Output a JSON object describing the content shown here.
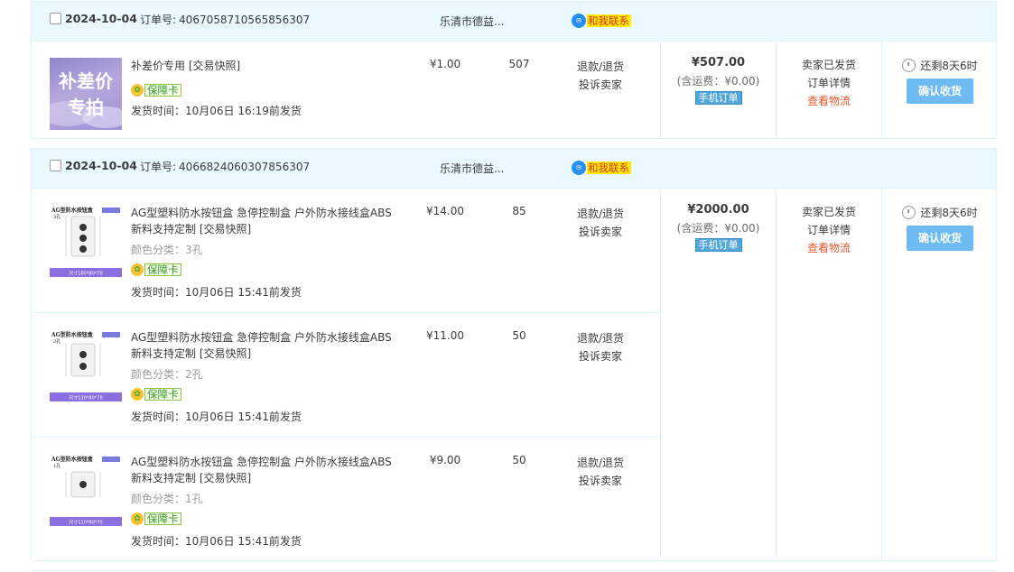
{
  "orders": [
    {
      "date": "2024-10-04",
      "order_label": "订单号:",
      "order_no": "4067058710565856307",
      "shop": "乐清市德益...",
      "contact": "和我联系",
      "items": [
        {
          "thumb_text": [
            "补差价",
            "专拍"
          ],
          "title": "补差价专用 [交易快照]",
          "sku": "",
          "guarantee": "保障卡",
          "ship": "发货时间：10月06日 16:19前发货",
          "price": "¥1.00",
          "qty": "507",
          "refund": "退款/退货",
          "complain": "投诉卖家"
        }
      ],
      "total": "¥507.00",
      "freight": "(含运费：¥0.00)",
      "mobile": "手机订单",
      "status": "卖家已发货",
      "detail": "订单详情",
      "logistics": "查看物流",
      "remain": "还剩8天6时",
      "confirm": "确认收货"
    },
    {
      "date": "2024-10-04",
      "order_label": "订单号:",
      "order_no": "4066824060307856307",
      "shop": "乐清市德益...",
      "contact": "和我联系",
      "items": [
        {
          "thumb_title": "AG型防水按钮盒",
          "thumb_sub": "3孔",
          "thumb_foot": "尺寸180*80*70",
          "title": "AG型塑料防水按钮盒 急停控制盒 户外防水接线盒ABS新料支持定制 [交易快照]",
          "sku": "颜色分类：3孔",
          "guarantee": "保障卡",
          "ship": "发货时间：10月06日 15:41前发货",
          "price": "¥14.00",
          "qty": "85",
          "refund": "退款/退货",
          "complain": "投诉卖家"
        },
        {
          "thumb_title": "AG型防水按钮盒",
          "thumb_sub": "2孔",
          "thumb_foot": "尺寸130*80*70",
          "title": "AG型塑料防水按钮盒 急停控制盒 户外防水接线盒ABS新料支持定制 [交易快照]",
          "sku": "颜色分类：2孔",
          "guarantee": "保障卡",
          "ship": "发货时间：10月06日 15:41前发货",
          "price": "¥11.00",
          "qty": "50",
          "refund": "退款/退货",
          "complain": "投诉卖家"
        },
        {
          "thumb_title": "AG型防水按钮盒",
          "thumb_sub": "1孔",
          "thumb_foot": "尺寸110*80*70",
          "title": "AG型塑料防水按钮盒 急停控制盒 户外防水接线盒ABS新料支持定制 [交易快照]",
          "sku": "颜色分类：1孔",
          "guarantee": "保障卡",
          "ship": "发货时间：10月06日 15:41前发货",
          "price": "¥9.00",
          "qty": "50",
          "refund": "退款/退货",
          "complain": "投诉卖家"
        }
      ],
      "total": "¥2000.00",
      "freight": "(含运费：¥0.00)",
      "mobile": "手机订单",
      "status": "卖家已发货",
      "detail": "订单详情",
      "logistics": "查看物流",
      "remain": "还剩8天6时",
      "confirm": "确认收货"
    }
  ],
  "colors": {
    "header_bg": "#eaf8ff",
    "border": "#daf3ff",
    "confirm_button": "#6dbbf2",
    "logistics_link": "#e4572e"
  }
}
